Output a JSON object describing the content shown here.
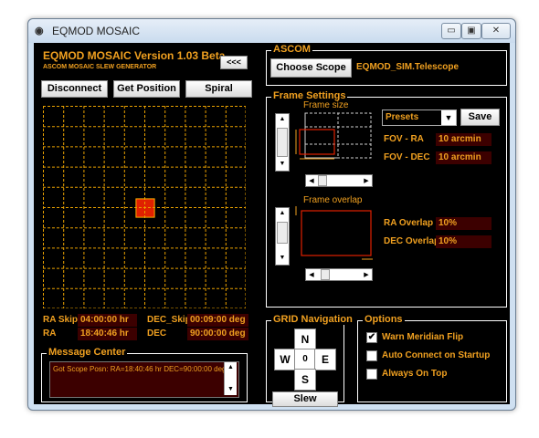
{
  "window": {
    "title": "EQMOD MOSAIC",
    "app_icon": "binoculars-icon",
    "min": "▭",
    "max": "▣",
    "close": "✕"
  },
  "header": {
    "app_name": "EQMOD MOSAIC Version 1.03 Beta",
    "subtitle": "ASCOM MOSAIC SLEW GENERATOR",
    "collapse_label": "<<<"
  },
  "toolbar": {
    "disconnect": "Disconnect",
    "get_position": "Get Position",
    "spiral": "Spiral"
  },
  "grid": {
    "cols": 10,
    "rows": 10,
    "highlight_col": 5,
    "highlight_row": 5,
    "line_color": "#e8a000",
    "cell_color": "#e02000"
  },
  "readouts": {
    "ra_skip_label": "RA Skip",
    "ra_skip": "04:00:00 hr",
    "dec_skip_label": "DEC_Skip",
    "dec_skip": "00:09:00 deg",
    "ra_label": "RA",
    "ra": "18:40:46 hr",
    "dec_label": "DEC",
    "dec": "90:00:00 deg"
  },
  "message_center": {
    "title": "Message Center",
    "text": "Got Scope Posn: RA=18:40:46 hr DEC=90:00:00 deg"
  },
  "ascom": {
    "title": "ASCOM",
    "choose_scope": "Choose Scope",
    "scope_name": "EQMOD_SIM.Telescope"
  },
  "frame_settings": {
    "title": "Frame Settings",
    "frame_size_label": "Frame size",
    "frame_overlap_label": "Frame overlap",
    "presets": "Presets",
    "save": "Save",
    "fov_ra_label": "FOV - RA",
    "fov_ra": "10 arcmin",
    "fov_dec_label": "FOV - DEC",
    "fov_dec": "10 arcmin",
    "ra_overlap_label": "RA Overlap",
    "ra_overlap": "10%",
    "dec_overlap_label": "DEC Overlap",
    "dec_overlap": "10%"
  },
  "grid_nav": {
    "title": "GRID Navigation",
    "n": "N",
    "s": "S",
    "e": "E",
    "w": "W",
    "center": "0",
    "slew": "Slew"
  },
  "options": {
    "title": "Options",
    "items": [
      {
        "label": "Warn Meridian Flip",
        "checked": "✔"
      },
      {
        "label": "Auto Connect on Startup",
        "checked": ""
      },
      {
        "label": "Always On Top",
        "checked": ""
      }
    ]
  }
}
